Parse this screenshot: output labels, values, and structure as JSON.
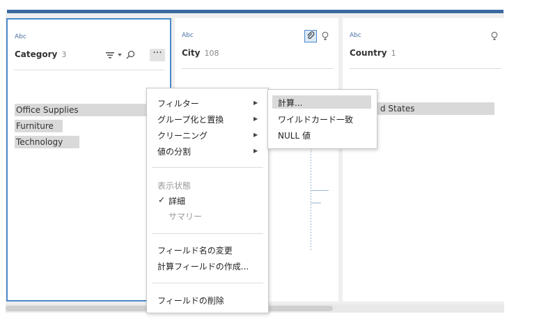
{
  "fields": [
    {
      "type": "Abc",
      "name": "Category",
      "count": "3"
    },
    {
      "type": "Abc",
      "name": "City",
      "count": "108"
    },
    {
      "type": "Abc",
      "name": "Country",
      "count": "1"
    }
  ],
  "category_values": [
    "Office Supplies",
    "Furniture",
    "Technology"
  ],
  "category_fill": [
    0.95,
    0.34,
    0.46
  ],
  "country_value": "d States",
  "context_menu": {
    "filter": "フィルター",
    "group_replace": "グループ化と置換",
    "cleaning": "クリーニング",
    "split_values": "値の分割",
    "display_state_label": "表示状態",
    "checkmark": "✓",
    "detail": "詳細",
    "summary": "サマリー",
    "rename_field": "フィールド名の変更",
    "create_calc_field": "計算フィールドの作成...",
    "remove_field": "フィールドの削除"
  },
  "submenu": {
    "calculation": "計算...",
    "wildcard_match": "ワイルドカード一致",
    "null_value": "NULL 値"
  },
  "more_label": "···"
}
